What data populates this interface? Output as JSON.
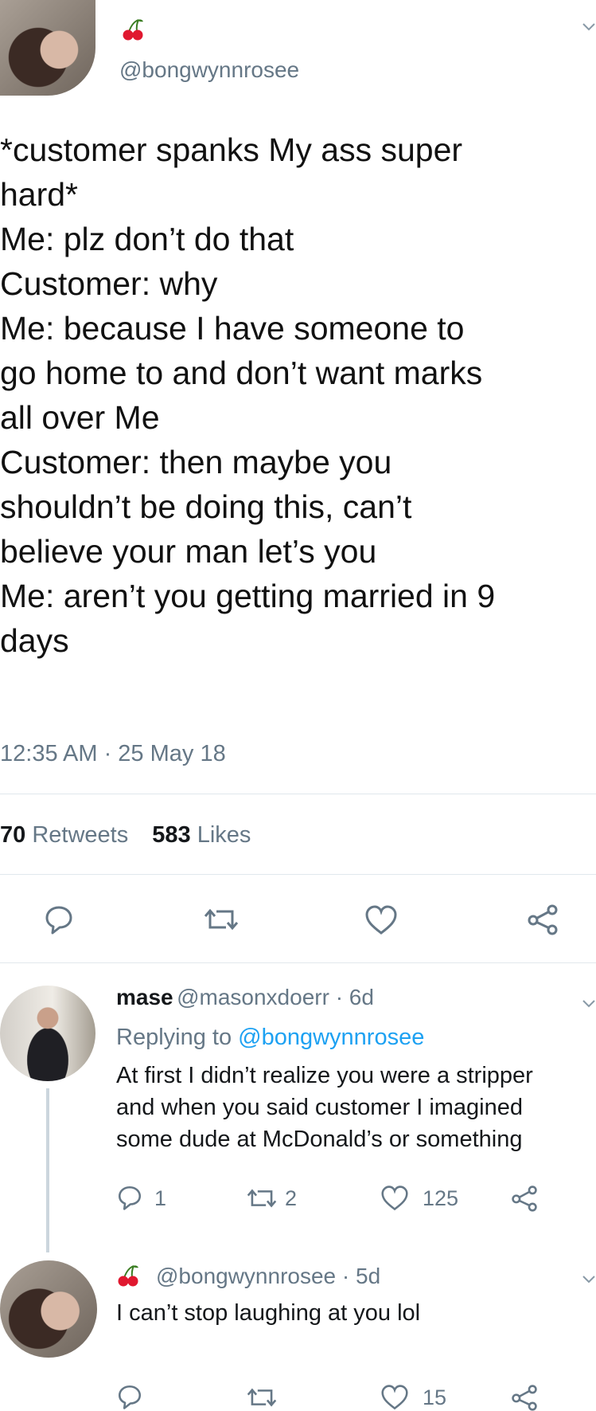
{
  "main_tweet": {
    "handle": "@bongwynnrosee",
    "text_lines": [
      "*customer spanks My ass super",
      "hard*",
      "Me: plz don’t do that",
      "Customer: why",
      "Me: because I have someone to",
      "go home to and don’t want marks",
      "all over Me",
      "Customer: then maybe you",
      "shouldn’t be doing this, can’t",
      "believe your man let’s you",
      "Me: aren’t you getting married in 9",
      "days"
    ],
    "timestamp": "12:35 AM · 25 May 18",
    "retweets_count": "70",
    "retweets_label": "Retweets",
    "likes_count": "583",
    "likes_label": "Likes"
  },
  "reply_1": {
    "name": "mase",
    "handle_time": "@masonxdoerr · 6d",
    "replying_prefix": "Replying to",
    "replying_handle": "@bongwynnrosee",
    "text_lines": [
      "At first I didn’t realize you were a stripper",
      "and when you said customer I imagined",
      "some dude at McDonald’s or something"
    ],
    "reply_count": "1",
    "retweet_count": "2",
    "like_count": "125"
  },
  "reply_2": {
    "handle_time": "@bongwynnrosee · 5d",
    "text": "I can’t stop laughing at you lol",
    "like_count": "15"
  },
  "colors": {
    "text": "#14171a",
    "secondary": "#657786",
    "link": "#1da1f2",
    "divider": "#e1e8ed",
    "cherry": "#e0182f"
  }
}
